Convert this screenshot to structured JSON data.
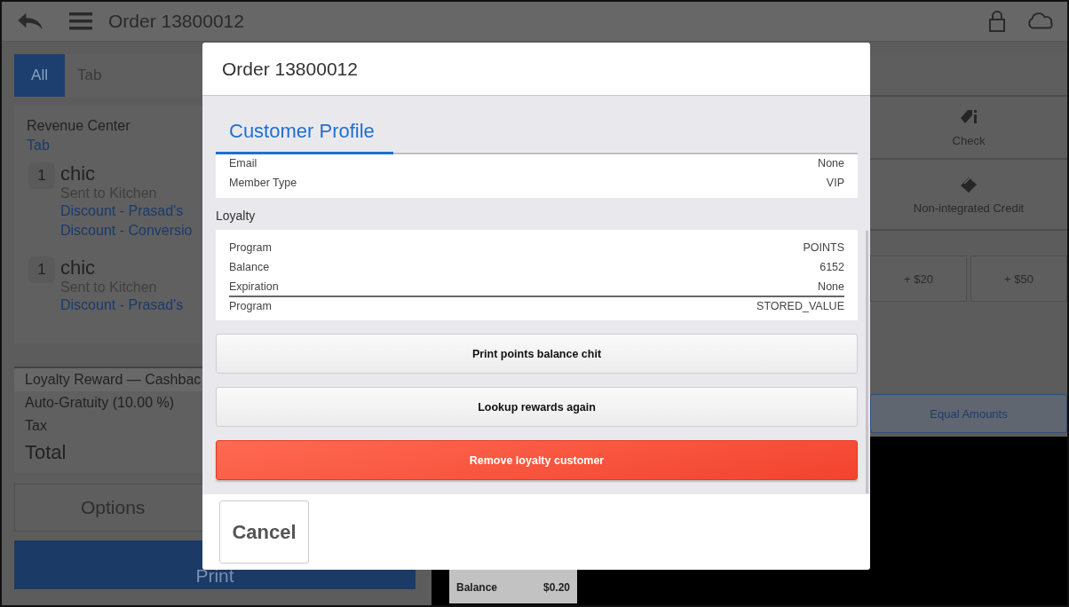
{
  "top_bar": {
    "title": "Order 13800012"
  },
  "order_tabs": [
    {
      "label": "All",
      "selected": true
    },
    {
      "label": "Tab",
      "selected": false
    }
  ],
  "revenue_center": {
    "label": "Revenue Center",
    "value": "Tab"
  },
  "items": [
    {
      "qty": "1",
      "name": "chic",
      "status": "Sent to Kitchen",
      "discounts": [
        "Discount - Prasad's",
        "Discount - Conversio"
      ]
    },
    {
      "qty": "1",
      "name": "chic",
      "status": "Sent to Kitchen",
      "discounts": [
        "Discount - Prasad's"
      ]
    }
  ],
  "summary": [
    {
      "label": "Loyalty Reward — Cashbac",
      "highlighted": true
    },
    {
      "label": "Auto-Gratuity (10.00 %)",
      "highlighted": false
    },
    {
      "label": "Tax",
      "highlighted": false
    }
  ],
  "total": "Total",
  "options_button": "Options",
  "print_button": "Print",
  "payment_tiles": [
    {
      "label": "Check",
      "kind": "check"
    },
    {
      "label": "Non-integrated Credit",
      "kind": "card"
    }
  ],
  "amount_buttons": [
    "+ $20",
    "+ $50"
  ],
  "equal_amounts_button": "Equal Amounts",
  "receipt": {
    "label": "Balance",
    "value": "$0.20"
  },
  "dialog": {
    "title": "Order 13800012",
    "tab": {
      "label": "Customer Profile",
      "selected": true
    },
    "profile_rows": [
      {
        "label": "Email",
        "value": "None"
      },
      {
        "label": "Member Type",
        "value": "VIP"
      }
    ],
    "loyalty_heading": "Loyalty",
    "loyalty_rows": [
      {
        "label": "Program",
        "value": "POINTS",
        "underlined": false
      },
      {
        "label": "Balance",
        "value": "6152",
        "underlined": false
      },
      {
        "label": "Expiration",
        "value": "None",
        "underlined": true
      },
      {
        "label": "Program",
        "value": "STORED_VALUE",
        "underlined": false
      }
    ],
    "buttons": [
      {
        "label": "Print points balance chit",
        "kind": "default"
      },
      {
        "label": "Lookup rewards again",
        "kind": "default"
      },
      {
        "label": "Remove loyalty customer",
        "kind": "danger"
      }
    ],
    "cancel_button": "Cancel"
  }
}
